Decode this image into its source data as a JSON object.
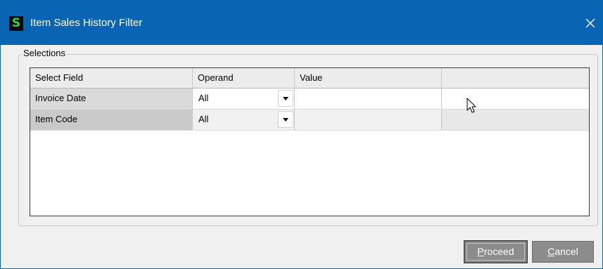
{
  "window": {
    "title": "Item Sales History Filter",
    "app_icon_glyph": "S",
    "icon_color": "#2fd64b",
    "titlebar_color": "#0a64b4"
  },
  "selections": {
    "label": "Selections",
    "columns": [
      "Select Field",
      "Operand",
      "Value",
      ""
    ],
    "rows": [
      {
        "field": "Invoice Date",
        "operand": "All",
        "value": "",
        "extra": ""
      },
      {
        "field": "Item Code",
        "operand": "All",
        "value": "",
        "extra": ""
      }
    ]
  },
  "buttons": {
    "proceed_mnemonic": "P",
    "proceed_rest": "roceed",
    "cancel_mnemonic": "C",
    "cancel_rest": "ancel"
  },
  "icons": {
    "close": "close-icon",
    "dropdown": "chevron-down-icon",
    "cursor": "mouse-pointer-icon"
  }
}
